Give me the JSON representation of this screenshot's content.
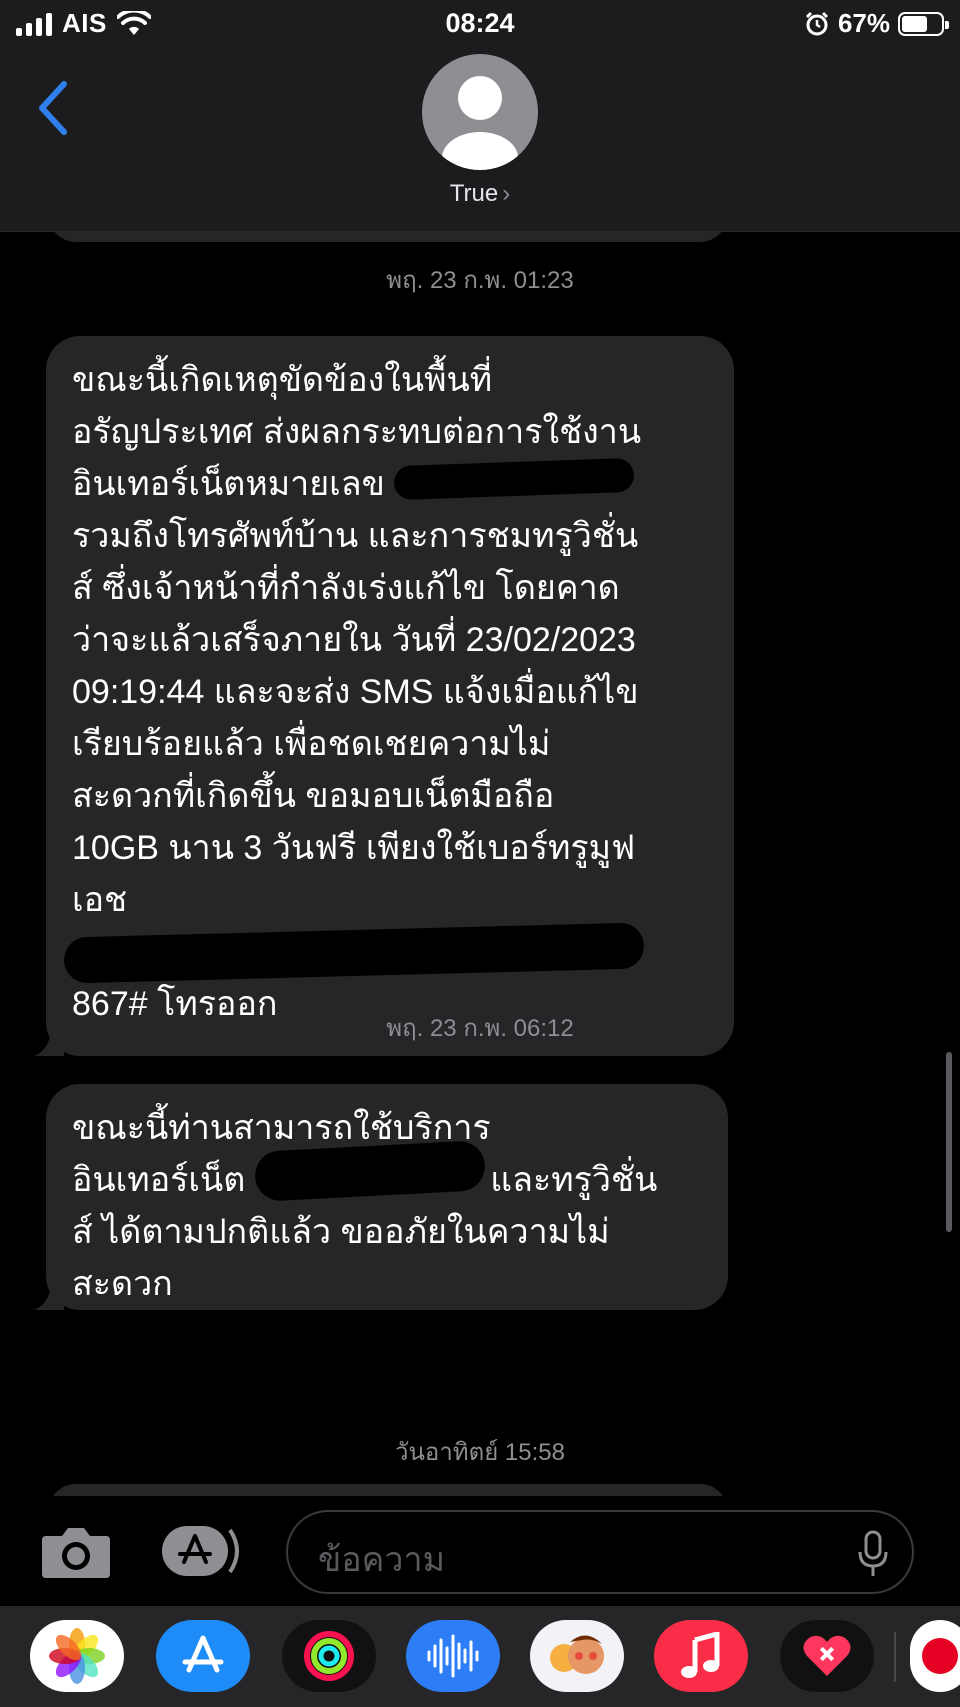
{
  "status_bar": {
    "carrier": "AIS",
    "time": "08:24",
    "battery_percent": "67%",
    "battery_level": 0.67,
    "icons": [
      "signal-icon",
      "wifi-icon",
      "alarm-icon",
      "battery-icon"
    ]
  },
  "header": {
    "contact_name": "True",
    "chevron": "›"
  },
  "messages": [
    {
      "timestamp": "พฤ. 23 ก.พ. 01:23",
      "lines": [
        "ขณะนี้เกิดเหตุขัดข้องในพื้นที่",
        "อรัญประเทศ ส่งผลกระทบต่อการใช้งาน",
        "อินเทอร์เน็ตหมายเลข",
        "รวมถึงโทรศัพท์บ้าน และการชมทรูวิชั่น",
        "ส์ ซึ่งเจ้าหน้าที่กำลังเร่งแก้ไข โดยคาด",
        "ว่าจะแล้วเสร็จภายใน วันที่ 23/02/2023",
        "09:19:44 และจะส่ง SMS แจ้งเมื่อแก้ไข",
        "เรียบร้อยแล้ว เพื่อชดเชยความไม่",
        "สะดวกที่เกิดขึ้น ขอมอบเน็ตมือถือ",
        "10GB นาน 3 วันฟรี เพียงใช้เบอร์ทรูมูฟ",
        "เอช",
        "",
        "867# โทรออก"
      ]
    },
    {
      "timestamp": "พฤ. 23 ก.พ. 06:12",
      "lines": [
        "ขณะนี้ท่านสามารถใช้บริการ",
        "อินเทอร์เน็ต",
        "และทรูวิชั่น",
        "ส์  ได้ตามปกติแล้ว ขออภัยในความไม่",
        "สะดวก"
      ]
    }
  ],
  "next_timestamp": "วันอาทิตย์ 15:58",
  "input": {
    "placeholder": "ข้อความ"
  },
  "dock_apps": [
    "photos-icon",
    "app-store-icon",
    "fitness-icon",
    "voice-memos-icon",
    "memoji-icon",
    "music-icon",
    "health-icon",
    "pinterest-icon"
  ],
  "colors": {
    "bubble": "#262628",
    "link": "#3a8bff",
    "header": "#1c1c1e",
    "accent_blue": "#2f80ed"
  }
}
